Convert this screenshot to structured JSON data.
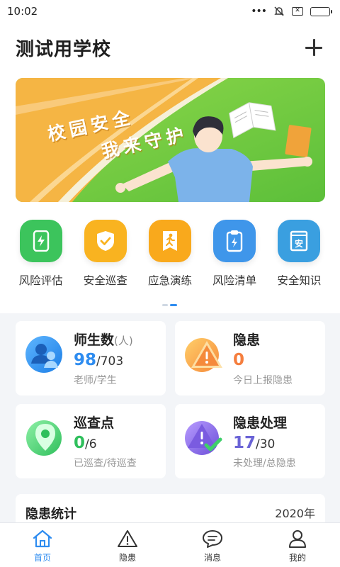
{
  "status_bar": {
    "time": "10:02",
    "dots": "•••",
    "x_icon": "✕"
  },
  "header": {
    "title": "测试用学校"
  },
  "banner": {
    "line1": "校园安全",
    "line2": "我来守护"
  },
  "quick_actions": [
    {
      "label": "风险评估",
      "icon": "lightning-card-icon",
      "color": "#3cc45c"
    },
    {
      "label": "安全巡查",
      "icon": "shield-check-icon",
      "color": "#f9b320"
    },
    {
      "label": "应急演练",
      "icon": "running-person-icon",
      "color": "#f9a91c"
    },
    {
      "label": "风险清单",
      "icon": "clipboard-icon",
      "color": "#3f96ea"
    },
    {
      "label": "安全知识",
      "icon": "book-icon",
      "color": "#3a9fe0"
    }
  ],
  "cards": {
    "people": {
      "title": "师生数",
      "unit": "(人)",
      "value": "98",
      "total": "/703",
      "desc": "老师/学生",
      "value_color": "#2e8cf0"
    },
    "hazard": {
      "title": "隐患",
      "value": "0",
      "desc": "今日上报隐患",
      "value_color": "#f57e3e"
    },
    "patrol": {
      "title": "巡查点",
      "value": "0",
      "total": "/6",
      "desc": "已巡查/待巡查",
      "value_color": "#2fbf5c"
    },
    "handling": {
      "title": "隐患处理",
      "value": "17",
      "total": "/30",
      "desc": "未处理/总隐患",
      "value_color": "#6a63d6"
    }
  },
  "stats": {
    "title": "隐患统计",
    "year": "2020年"
  },
  "tabbar": [
    {
      "label": "首页",
      "icon": "home-icon",
      "active": true
    },
    {
      "label": "隐患",
      "icon": "warning-triangle-icon",
      "active": false
    },
    {
      "label": "消息",
      "icon": "chat-bubble-icon",
      "active": false
    },
    {
      "label": "我的",
      "icon": "user-icon",
      "active": false
    }
  ],
  "colors": {
    "accent": "#2e8cf0",
    "background": "#f3f5f8"
  }
}
